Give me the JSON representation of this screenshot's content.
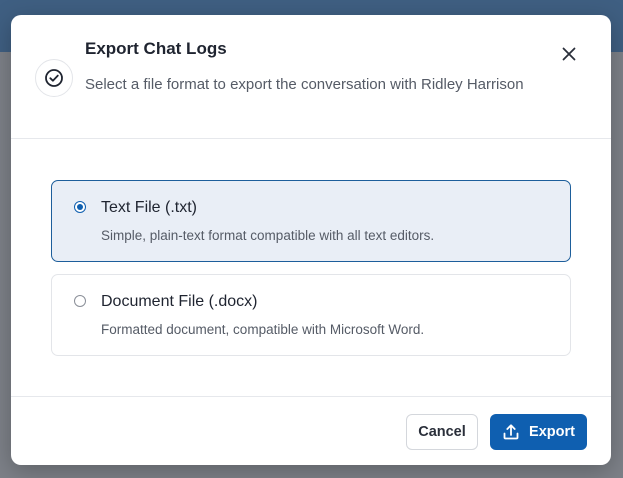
{
  "dialog": {
    "title": "Export Chat Logs",
    "subtitle": "Select a file format to export the conversation with Ridley Harrison",
    "header_icon": "check-circle-icon",
    "close_icon": "close-icon"
  },
  "options": [
    {
      "label": "Text File (.txt)",
      "description": "Simple, plain-text format compatible with all text editors.",
      "selected": true
    },
    {
      "label": "Document File (.docx)",
      "description": "Formatted document, compatible with Microsoft Word.",
      "selected": false
    }
  ],
  "footer": {
    "cancel_label": "Cancel",
    "export_label": "Export",
    "export_icon": "upload-icon"
  },
  "colors": {
    "accent": "#0f5fb0",
    "selected_bg": "#e9eef6",
    "selected_border": "#1d5e9b"
  }
}
